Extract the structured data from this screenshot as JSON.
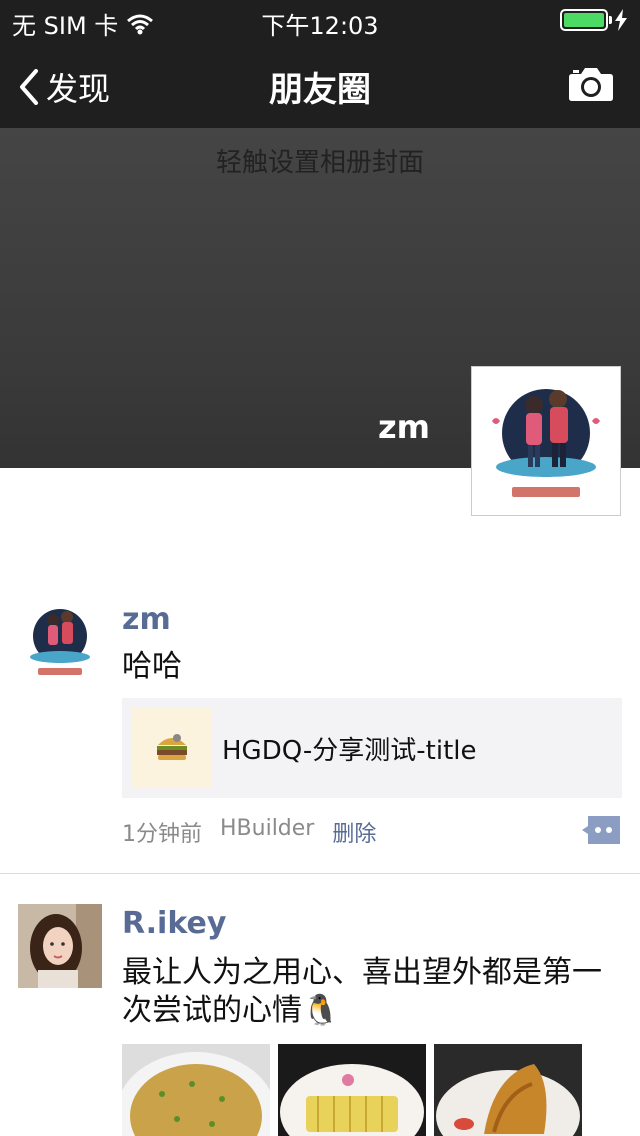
{
  "status_bar": {
    "carrier": "无 SIM 卡",
    "time": "下午12:03",
    "battery_level": 1.0
  },
  "nav": {
    "back_label": "发现",
    "title": "朋友圈",
    "camera_icon": "camera-icon"
  },
  "cover": {
    "hint": "轻触设置相册封面",
    "user_name": "zm"
  },
  "posts": [
    {
      "user": "zm",
      "text": "哈哈",
      "link_title": "HGDQ-分享测试-title",
      "time": "1分钟前",
      "source": "HBuilder",
      "delete_label": "删除"
    },
    {
      "user": "R.ikey",
      "text": "最让人为之用心、喜出望外都是第一次尝试的心情🐧"
    }
  ],
  "colors": {
    "bar_bg": "#1f1f20",
    "link_blue": "#576b95",
    "battery_green": "#4cd964"
  }
}
